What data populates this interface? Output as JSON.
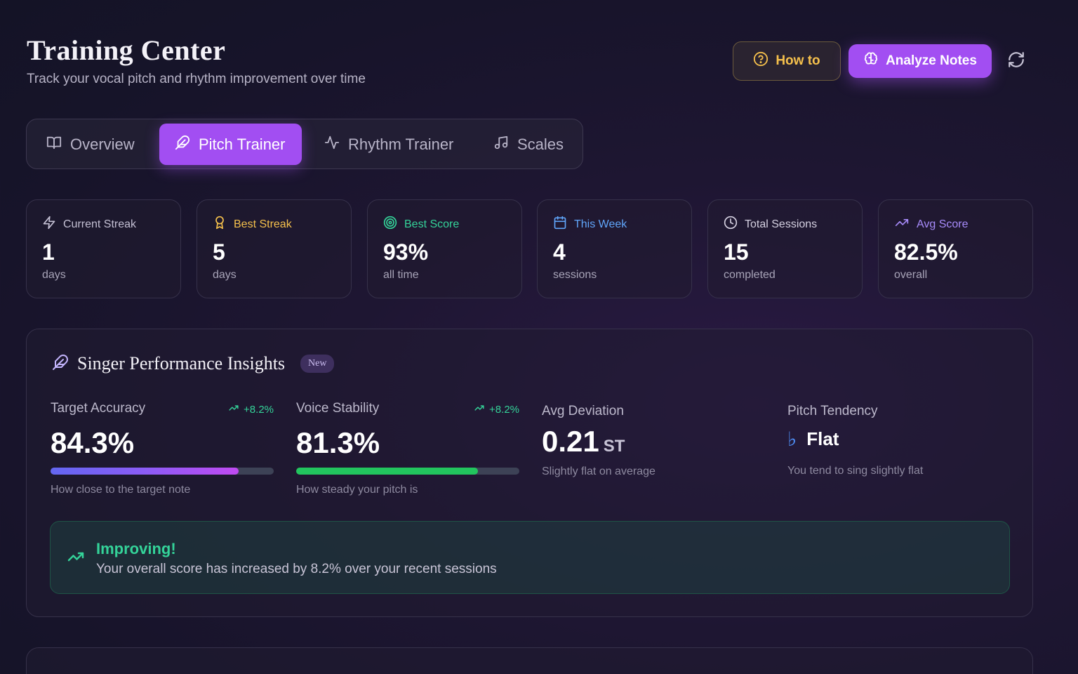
{
  "header": {
    "title": "Training Center",
    "subtitle": "Track your vocal pitch and rhythm improvement over time",
    "how_to_label": "How to",
    "analyze_label": "Analyze Notes"
  },
  "tabs": [
    {
      "label": "Overview",
      "icon": "book-icon",
      "active": false
    },
    {
      "label": "Pitch Trainer",
      "icon": "feather-icon",
      "active": true
    },
    {
      "label": "Rhythm Trainer",
      "icon": "pulse-icon",
      "active": false
    },
    {
      "label": "Scales",
      "icon": "music-note-icon",
      "active": false
    }
  ],
  "stats": [
    {
      "label": "Current Streak",
      "value": "1",
      "unit": "days",
      "icon": "lightning-icon",
      "color": "#c4c0d4"
    },
    {
      "label": "Best Streak",
      "value": "5",
      "unit": "days",
      "icon": "award-icon",
      "color": "#f5c04c"
    },
    {
      "label": "Best Score",
      "value": "93%",
      "unit": "all time",
      "icon": "target-icon",
      "color": "#34d399"
    },
    {
      "label": "This Week",
      "value": "4",
      "unit": "sessions",
      "icon": "calendar-icon",
      "color": "#60a5fa"
    },
    {
      "label": "Total Sessions",
      "value": "15",
      "unit": "completed",
      "icon": "clock-icon",
      "color": "#d4d0e0"
    },
    {
      "label": "Avg Score",
      "value": "82.5%",
      "unit": "overall",
      "icon": "trending-up-icon",
      "color": "#a78bfa"
    }
  ],
  "insights": {
    "title": "Singer Performance Insights",
    "badge": "New",
    "target_accuracy": {
      "label": "Target Accuracy",
      "trend": "+8.2%",
      "value": "84.3%",
      "progress": 0.843,
      "description": "How close to the target note",
      "bar_color": "#8b5cf6"
    },
    "voice_stability": {
      "label": "Voice Stability",
      "trend": "+8.2%",
      "value": "81.3%",
      "progress": 0.813,
      "description": "How steady your pitch is",
      "bar_color": "#22c55e"
    },
    "avg_deviation": {
      "label": "Avg Deviation",
      "value": "0.21",
      "unit": "ST",
      "description": "Slightly flat on average"
    },
    "pitch_tendency": {
      "label": "Pitch Tendency",
      "symbol": "♭",
      "value": "Flat",
      "description": "You tend to sing slightly flat"
    },
    "improving": {
      "title": "Improving!",
      "text": "Your overall score has increased by 8.2% over your recent sessions"
    }
  }
}
